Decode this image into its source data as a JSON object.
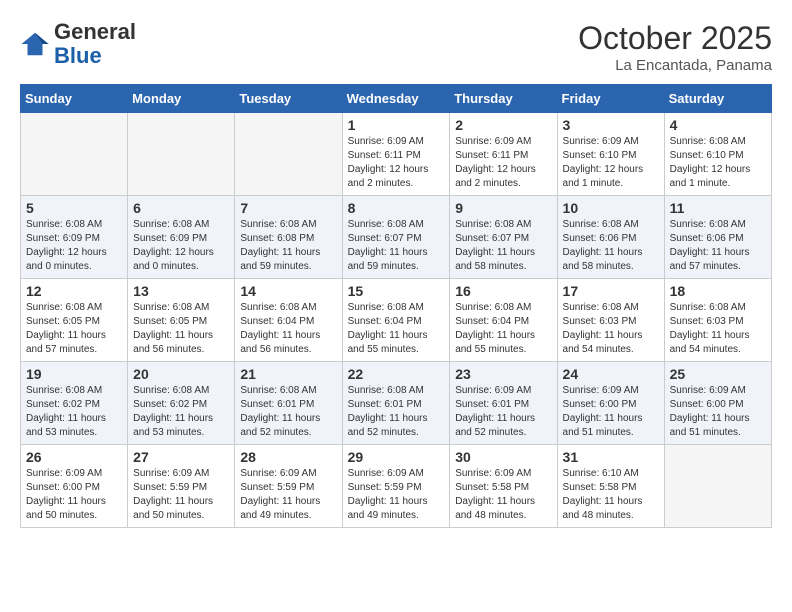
{
  "header": {
    "logo_general": "General",
    "logo_blue": "Blue",
    "month": "October 2025",
    "location": "La Encantada, Panama"
  },
  "weekdays": [
    "Sunday",
    "Monday",
    "Tuesday",
    "Wednesday",
    "Thursday",
    "Friday",
    "Saturday"
  ],
  "weeks": [
    [
      {
        "day": "",
        "info": ""
      },
      {
        "day": "",
        "info": ""
      },
      {
        "day": "",
        "info": ""
      },
      {
        "day": "1",
        "info": "Sunrise: 6:09 AM\nSunset: 6:11 PM\nDaylight: 12 hours and 2 minutes."
      },
      {
        "day": "2",
        "info": "Sunrise: 6:09 AM\nSunset: 6:11 PM\nDaylight: 12 hours and 2 minutes."
      },
      {
        "day": "3",
        "info": "Sunrise: 6:09 AM\nSunset: 6:10 PM\nDaylight: 12 hours and 1 minute."
      },
      {
        "day": "4",
        "info": "Sunrise: 6:08 AM\nSunset: 6:10 PM\nDaylight: 12 hours and 1 minute."
      }
    ],
    [
      {
        "day": "5",
        "info": "Sunrise: 6:08 AM\nSunset: 6:09 PM\nDaylight: 12 hours and 0 minutes."
      },
      {
        "day": "6",
        "info": "Sunrise: 6:08 AM\nSunset: 6:09 PM\nDaylight: 12 hours and 0 minutes."
      },
      {
        "day": "7",
        "info": "Sunrise: 6:08 AM\nSunset: 6:08 PM\nDaylight: 11 hours and 59 minutes."
      },
      {
        "day": "8",
        "info": "Sunrise: 6:08 AM\nSunset: 6:07 PM\nDaylight: 11 hours and 59 minutes."
      },
      {
        "day": "9",
        "info": "Sunrise: 6:08 AM\nSunset: 6:07 PM\nDaylight: 11 hours and 58 minutes."
      },
      {
        "day": "10",
        "info": "Sunrise: 6:08 AM\nSunset: 6:06 PM\nDaylight: 11 hours and 58 minutes."
      },
      {
        "day": "11",
        "info": "Sunrise: 6:08 AM\nSunset: 6:06 PM\nDaylight: 11 hours and 57 minutes."
      }
    ],
    [
      {
        "day": "12",
        "info": "Sunrise: 6:08 AM\nSunset: 6:05 PM\nDaylight: 11 hours and 57 minutes."
      },
      {
        "day": "13",
        "info": "Sunrise: 6:08 AM\nSunset: 6:05 PM\nDaylight: 11 hours and 56 minutes."
      },
      {
        "day": "14",
        "info": "Sunrise: 6:08 AM\nSunset: 6:04 PM\nDaylight: 11 hours and 56 minutes."
      },
      {
        "day": "15",
        "info": "Sunrise: 6:08 AM\nSunset: 6:04 PM\nDaylight: 11 hours and 55 minutes."
      },
      {
        "day": "16",
        "info": "Sunrise: 6:08 AM\nSunset: 6:04 PM\nDaylight: 11 hours and 55 minutes."
      },
      {
        "day": "17",
        "info": "Sunrise: 6:08 AM\nSunset: 6:03 PM\nDaylight: 11 hours and 54 minutes."
      },
      {
        "day": "18",
        "info": "Sunrise: 6:08 AM\nSunset: 6:03 PM\nDaylight: 11 hours and 54 minutes."
      }
    ],
    [
      {
        "day": "19",
        "info": "Sunrise: 6:08 AM\nSunset: 6:02 PM\nDaylight: 11 hours and 53 minutes."
      },
      {
        "day": "20",
        "info": "Sunrise: 6:08 AM\nSunset: 6:02 PM\nDaylight: 11 hours and 53 minutes."
      },
      {
        "day": "21",
        "info": "Sunrise: 6:08 AM\nSunset: 6:01 PM\nDaylight: 11 hours and 52 minutes."
      },
      {
        "day": "22",
        "info": "Sunrise: 6:08 AM\nSunset: 6:01 PM\nDaylight: 11 hours and 52 minutes."
      },
      {
        "day": "23",
        "info": "Sunrise: 6:09 AM\nSunset: 6:01 PM\nDaylight: 11 hours and 52 minutes."
      },
      {
        "day": "24",
        "info": "Sunrise: 6:09 AM\nSunset: 6:00 PM\nDaylight: 11 hours and 51 minutes."
      },
      {
        "day": "25",
        "info": "Sunrise: 6:09 AM\nSunset: 6:00 PM\nDaylight: 11 hours and 51 minutes."
      }
    ],
    [
      {
        "day": "26",
        "info": "Sunrise: 6:09 AM\nSunset: 6:00 PM\nDaylight: 11 hours and 50 minutes."
      },
      {
        "day": "27",
        "info": "Sunrise: 6:09 AM\nSunset: 5:59 PM\nDaylight: 11 hours and 50 minutes."
      },
      {
        "day": "28",
        "info": "Sunrise: 6:09 AM\nSunset: 5:59 PM\nDaylight: 11 hours and 49 minutes."
      },
      {
        "day": "29",
        "info": "Sunrise: 6:09 AM\nSunset: 5:59 PM\nDaylight: 11 hours and 49 minutes."
      },
      {
        "day": "30",
        "info": "Sunrise: 6:09 AM\nSunset: 5:58 PM\nDaylight: 11 hours and 48 minutes."
      },
      {
        "day": "31",
        "info": "Sunrise: 6:10 AM\nSunset: 5:58 PM\nDaylight: 11 hours and 48 minutes."
      },
      {
        "day": "",
        "info": ""
      }
    ]
  ]
}
